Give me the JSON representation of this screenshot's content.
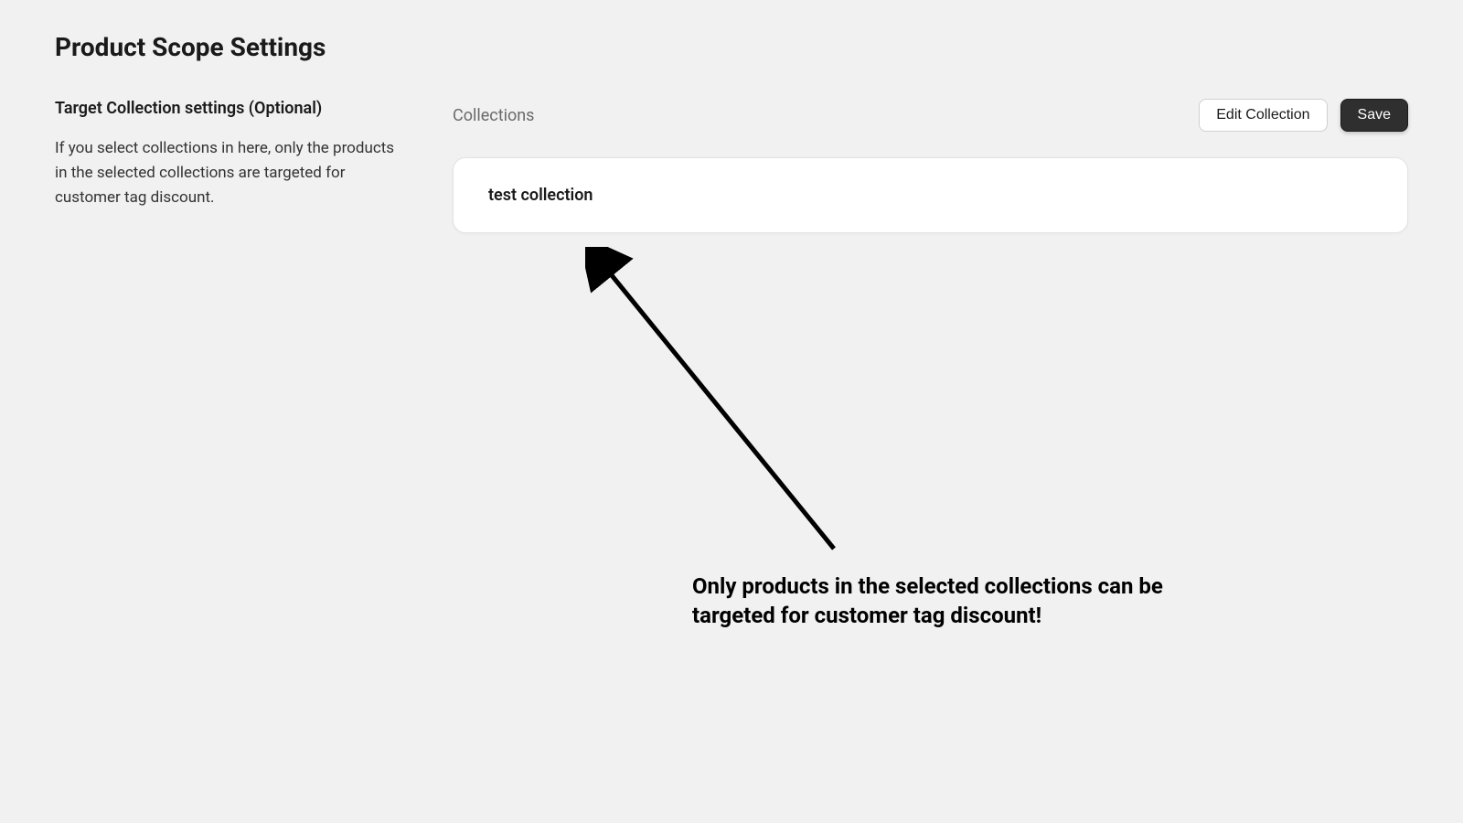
{
  "page": {
    "title": "Product Scope Settings"
  },
  "sidebar": {
    "subtitle": "Target Collection settings (Optional)",
    "help": "If you select collections in here, only the products in the selected collections are targeted for customer tag discount."
  },
  "main": {
    "collections_label": "Collections",
    "edit_button": "Edit Collection",
    "save_button": "Save",
    "selected_collection": "test collection"
  },
  "annotation": {
    "text": "Only products in the selected collections can be targeted for customer tag discount!"
  }
}
